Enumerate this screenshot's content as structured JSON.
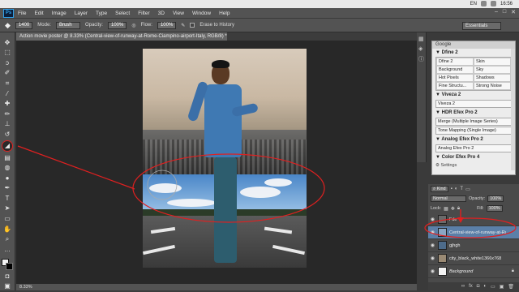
{
  "system_bar": {
    "lang": "EN",
    "time": "16:56"
  },
  "menu": [
    "File",
    "Edit",
    "Image",
    "Layer",
    "Type",
    "Select",
    "Filter",
    "3D",
    "View",
    "Window",
    "Help"
  ],
  "app_logo": "Ps",
  "options": {
    "brush_size": "1400",
    "mode_label": "Mode:",
    "mode_value": "Brush",
    "opacity_label": "Opacity:",
    "opacity_value": "100%",
    "flow_label": "Flow:",
    "flow_value": "100%",
    "erase_history_label": "Erase to History",
    "workspace": "Essentials"
  },
  "document": {
    "tab_title": "Action movie poster @ 8.33% (Central-view-of-runway-at-Rome-Ciampino-airport-Italy, RGB/8) *",
    "zoom": "8.33%"
  },
  "google_panel": {
    "title": "Google",
    "sections": [
      {
        "name": "Dfine 2",
        "cells": [
          "Dfine 2",
          "Skin",
          "Background",
          "Sky",
          "Hot Pixels",
          "Shadows",
          "Fine Structu...",
          "Strong Noise"
        ]
      },
      {
        "name": "Viveza 2",
        "items": [
          "Viveza 2"
        ]
      },
      {
        "name": "HDR Efex Pro 2",
        "items": [
          "Merge (Multiple Image Series)",
          "Tone Mapping (Single Image)"
        ]
      },
      {
        "name": "Analog Efex Pro 2",
        "items": [
          "Analog Efex Pro 2"
        ]
      },
      {
        "name": "Color Efex Pro 4",
        "items": []
      }
    ],
    "settings_label": "Settings"
  },
  "layers": {
    "kind_label": "Kind",
    "blend_mode": "Normal",
    "opacity_label": "Opacity:",
    "opacity_value": "100%",
    "lock_label": "Lock:",
    "fill_label": "Fill:",
    "fill_value": "100%",
    "items": [
      {
        "name": "Fde",
        "selected": false
      },
      {
        "name": "Central-view-of-runway-at-Ro...",
        "selected": true
      },
      {
        "name": "gjhgh",
        "selected": false
      },
      {
        "name": "city_black_white1366x768",
        "selected": false
      },
      {
        "name": "Background",
        "selected": false
      }
    ]
  },
  "colors": {
    "accent": "#2fa0e8",
    "selection": "#5b7fa8",
    "annotation": "#e02020"
  }
}
